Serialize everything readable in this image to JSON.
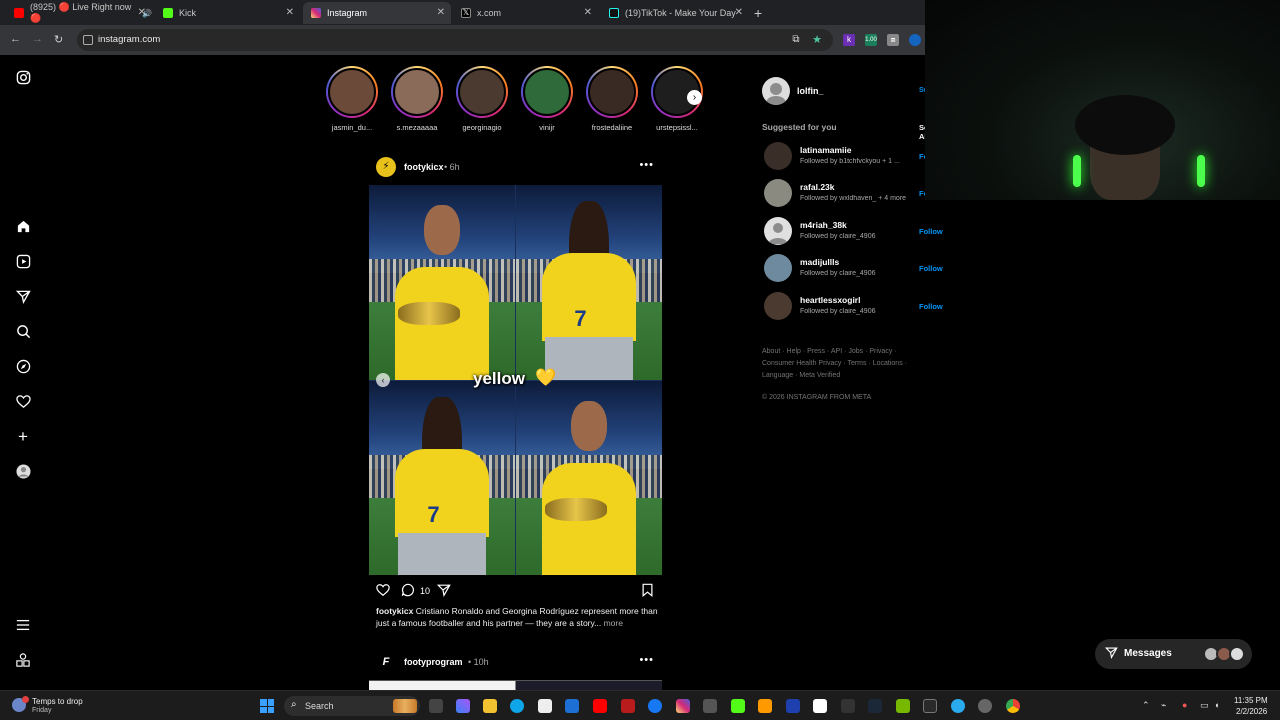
{
  "browser": {
    "tabs": [
      {
        "label": "(8925) 🔴 Live Right now 🔴",
        "icon": "youtube-icon",
        "color": "#ff0000",
        "active": false
      },
      {
        "label": "Kick",
        "icon": "kick-icon",
        "color": "#53fc18",
        "active": false
      },
      {
        "label": "Instagram",
        "icon": "instagram-icon",
        "color": "#d62976",
        "active": true
      },
      {
        "label": "x.com",
        "icon": "x-icon",
        "color": "#ffffff",
        "active": false
      },
      {
        "label": "(19)TikTok - Make Your Day",
        "icon": "tiktok-icon",
        "color": "#25f4ee",
        "active": false
      }
    ],
    "url": "instagram.com"
  },
  "stories": [
    {
      "name": "jasmin_du...",
      "color": "#6b4a3a"
    },
    {
      "name": "s.mezaaaaa",
      "color": "#8a6b5a"
    },
    {
      "name": "georginagio",
      "color": "#4a3a30"
    },
    {
      "name": "vinijr",
      "color": "#2f6a3a"
    },
    {
      "name": "frostedaliine",
      "color": "#3a2a24"
    },
    {
      "name": "urstepsissl...",
      "color": "#1e1e1e"
    }
  ],
  "post": {
    "username": "footykicx",
    "time": "• 6h",
    "overlay_text": "yellow",
    "overlay_emoji": "💛",
    "comment_count": "10",
    "caption_user": "footykicx",
    "caption_text": " Cristiano Ronaldo and Georgina Rodríguez represent more than just a famous footballer and his partner — they are a story...",
    "caption_more": " more"
  },
  "post2": {
    "username": "footyprogram",
    "time": "• 10h"
  },
  "right": {
    "me": "lolfin_",
    "me_switch": "Switch",
    "suggested_title": "Suggested for you",
    "see_all": "See All",
    "suggestions": [
      {
        "username": "latinamamiie",
        "sub": "Followed by b1tchfvckyou + 1 ...",
        "follow": "Follow",
        "color": "#3a2e28"
      },
      {
        "username": "rafal.23k",
        "sub": "Followed by wxldhaven_ + 4 more",
        "follow": "Follow",
        "color": "#8a8a80"
      },
      {
        "username": "m4riah_38k",
        "sub": "Followed by claire_4906",
        "follow": "Follow",
        "color": "#dadada"
      },
      {
        "username": "madijullls",
        "sub": "Followed by claire_4906",
        "follow": "Follow",
        "color": "#6e8a9e"
      },
      {
        "username": "heartlessxogirl",
        "sub": "Followed by claire_4906",
        "follow": "Follow",
        "color": "#4a3a30"
      }
    ],
    "footer": "About · Help · Press · API · Jobs · Privacy · Consumer Health Privacy · Terms · Locations · Language · Meta Verified",
    "copyright": "© 2026 INSTAGRAM FROM META"
  },
  "messages": {
    "label": "Messages"
  },
  "taskbar": {
    "weather_line1": "Temps to drop",
    "weather_line2": "Friday",
    "search_label": "Search",
    "time": "11:35 PM",
    "date": "2/2/2026"
  }
}
